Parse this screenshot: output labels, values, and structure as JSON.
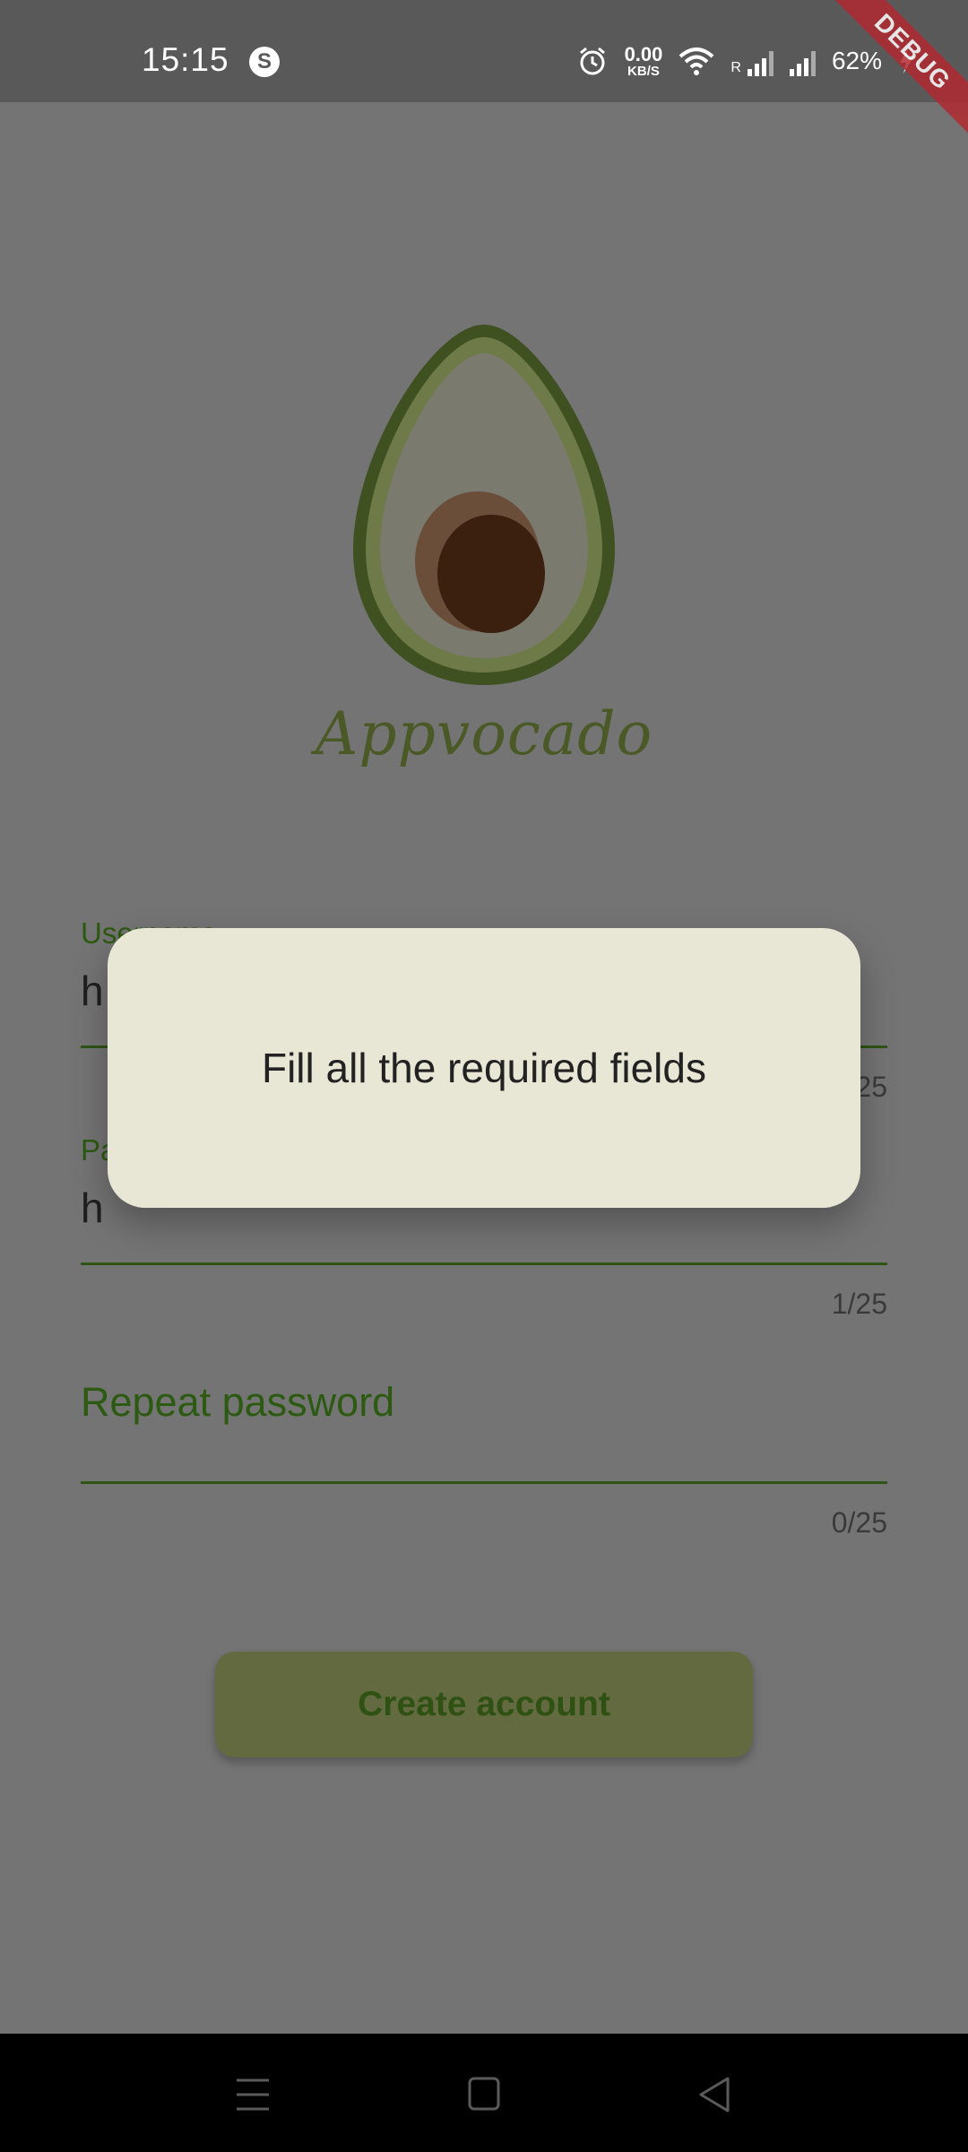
{
  "status_bar": {
    "time": "15:15",
    "speed_value": "0.00",
    "speed_unit": "KB/S",
    "roaming": "R",
    "battery": "62%",
    "icons": [
      "s-app-icon",
      "alarm-icon",
      "wifi-icon",
      "signal-icon",
      "signal-icon",
      "charging-icon"
    ]
  },
  "debug_banner": "DEBUG",
  "app": {
    "name": "Appvocado",
    "logo_icon": "avocado-logo-icon",
    "colors": {
      "primary": "#2e5416",
      "avocado_skin": "#3f5021",
      "avocado_flesh": "#6e7a48",
      "pit": "#3b1f0f",
      "button": "#636a40"
    }
  },
  "form": {
    "username": {
      "label": "Username",
      "value": "h",
      "counter": "1/25"
    },
    "password": {
      "label": "Password",
      "value": "h",
      "counter": "1/25"
    },
    "repeat_password": {
      "label": "Repeat password",
      "value": "",
      "counter": "0/25"
    },
    "submit_label": "Create account"
  },
  "dialog": {
    "message": "Fill all the required fields"
  },
  "nav_bar": {
    "icons": [
      "menu-icon",
      "home-square-icon",
      "back-triangle-icon"
    ]
  }
}
